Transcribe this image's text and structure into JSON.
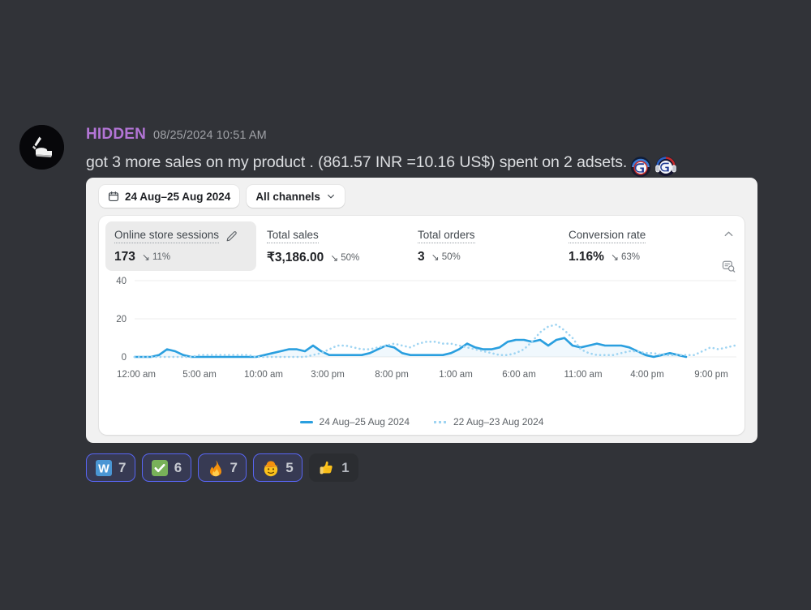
{
  "message": {
    "username": "HIDDEN",
    "timestamp": "08/25/2024 10:51 AM",
    "text": "got 3 more sales on my product . (861.57 INR =10.16 US$) spent on 2 adsets.",
    "avatar_icon": "kayak-avatar-icon",
    "inline_emojis": [
      {
        "name": "g-logo-cap-emoji"
      },
      {
        "name": "g-logo-headphones-emoji"
      }
    ],
    "username_color": "#b375d6",
    "timestamp_color": "#a0a2a7"
  },
  "embed": {
    "toolbar": {
      "date_range": "24 Aug–25 Aug 2024",
      "date_icon": "calendar-icon",
      "channel_filter": "All channels",
      "channel_chevron_icon": "chevron-down-icon"
    },
    "actions": {
      "collapse_icon": "chevron-up-icon",
      "explore_icon": "magnify-chart-icon"
    },
    "metrics": [
      {
        "label": "Online store sessions",
        "value": "173",
        "delta": "11%",
        "delta_direction": "down",
        "selected": true,
        "edit_icon": "pencil-icon"
      },
      {
        "label": "Total sales",
        "value": "₹3,186.00",
        "delta": "50%",
        "delta_direction": "down",
        "selected": false
      },
      {
        "label": "Total orders",
        "value": "3",
        "delta": "50%",
        "delta_direction": "down",
        "selected": false
      },
      {
        "label": "Conversion rate",
        "value": "1.16%",
        "delta": "63%",
        "delta_direction": "down",
        "selected": false
      }
    ],
    "legend": [
      {
        "label": "24 Aug–25 Aug 2024",
        "style": "solid",
        "color": "#2a9fdf"
      },
      {
        "label": "22 Aug–23 Aug 2024",
        "style": "dotted",
        "color": "#9ed4f2"
      }
    ]
  },
  "chart_data": {
    "type": "line",
    "title": "Online store sessions",
    "xlabel": "",
    "ylabel": "",
    "grid": true,
    "legend_position": "bottom",
    "ylim": [
      0,
      48
    ],
    "yticks": [
      0,
      20,
      40
    ],
    "ytick_labels": [
      "0",
      "20",
      "40"
    ],
    "xticks": [
      "12:00 am",
      "5:00 am",
      "10:00 am",
      "3:00 pm",
      "8:00 pm",
      "1:00 am",
      "6:00 am",
      "11:00 am",
      "4:00 pm",
      "9:00 pm"
    ],
    "series": [
      {
        "name": "24 Aug–25 Aug 2024",
        "style": "solid",
        "color": "#2a9fdf",
        "values": [
          0,
          0,
          0,
          0,
          1,
          4,
          3,
          1,
          0,
          0,
          0,
          0,
          0,
          0,
          0,
          0,
          0,
          0,
          1,
          2,
          3,
          4,
          4,
          3,
          1,
          6,
          3,
          1,
          1,
          1,
          1,
          1,
          2,
          4,
          6,
          5,
          2,
          1,
          1,
          1,
          1,
          1,
          1,
          2,
          4,
          7,
          5,
          4,
          4,
          5,
          8,
          9,
          9,
          8,
          9,
          6,
          9,
          10,
          6,
          5,
          6,
          7,
          6,
          6,
          6,
          5,
          3,
          1,
          0,
          1,
          2,
          1,
          0
        ]
      },
      {
        "name": "22 Aug–23 Aug 2024",
        "style": "dotted",
        "color": "#9ed4f2",
        "values": [
          0,
          0,
          0,
          0,
          0,
          0,
          0,
          0,
          1,
          1,
          1,
          1,
          1,
          1,
          1,
          0,
          0,
          0,
          0,
          0,
          0,
          0,
          1,
          2,
          4,
          6,
          6,
          5,
          4,
          4,
          5,
          6,
          7,
          6,
          5,
          7,
          8,
          8,
          7,
          7,
          6,
          5,
          4,
          3,
          2,
          1,
          1,
          2,
          4,
          8,
          13,
          16,
          17,
          14,
          10,
          4,
          2,
          1,
          1,
          1,
          2,
          3,
          3,
          2,
          2,
          2,
          1,
          1,
          1,
          1,
          1,
          3,
          5
        ]
      }
    ]
  },
  "reactions": [
    {
      "name": "w-emoji",
      "count": "7",
      "active": true
    },
    {
      "name": "white-check-mark-emoji",
      "count": "6",
      "active": true
    },
    {
      "name": "fire-emoji",
      "count": "7",
      "active": true
    },
    {
      "name": "cowboy-hat-face-emoji",
      "count": "5",
      "active": true
    },
    {
      "name": "thumbs-up-emoji",
      "count": "1",
      "active": false
    }
  ]
}
